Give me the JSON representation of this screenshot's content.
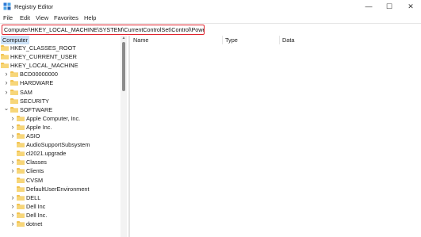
{
  "window": {
    "title": "Registry Editor",
    "controls": {
      "minimize": "—",
      "maximize": "☐",
      "close": "✕"
    }
  },
  "menu": [
    "File",
    "Edit",
    "View",
    "Favorites",
    "Help"
  ],
  "address": {
    "value": "Computer\\HKEY_LOCAL_MACHINE\\SYSTEM\\CurrentControlSet\\Control\\Power"
  },
  "tree": {
    "root": "Computer",
    "items": [
      {
        "label": "HKEY_CLASSES_ROOT",
        "level": 0,
        "expandable": false
      },
      {
        "label": "HKEY_CURRENT_USER",
        "level": 0,
        "expandable": false
      },
      {
        "label": "HKEY_LOCAL_MACHINE",
        "level": 0,
        "expandable": false
      },
      {
        "label": "BCD00000000",
        "level": 1,
        "expandable": true
      },
      {
        "label": "HARDWARE",
        "level": 1,
        "expandable": true
      },
      {
        "label": "SAM",
        "level": 1,
        "expandable": true
      },
      {
        "label": "SECURITY",
        "level": 1,
        "expandable": false
      },
      {
        "label": "SOFTWARE",
        "level": 1,
        "expandable": true,
        "expanded": true
      },
      {
        "label": "Apple Computer, Inc.",
        "level": 2,
        "expandable": true
      },
      {
        "label": "Apple Inc.",
        "level": 2,
        "expandable": true
      },
      {
        "label": "ASIO",
        "level": 2,
        "expandable": true
      },
      {
        "label": "AudioSupportSubsystem",
        "level": 2,
        "expandable": false
      },
      {
        "label": "cl2021.upgrade",
        "level": 2,
        "expandable": false
      },
      {
        "label": "Classes",
        "level": 2,
        "expandable": true
      },
      {
        "label": "Clients",
        "level": 2,
        "expandable": true
      },
      {
        "label": "CVSM",
        "level": 2,
        "expandable": false
      },
      {
        "label": "DefaultUserEnvironment",
        "level": 2,
        "expandable": false
      },
      {
        "label": "DELL",
        "level": 2,
        "expandable": true
      },
      {
        "label": "Dell Inc",
        "level": 2,
        "expandable": true
      },
      {
        "label": "Dell Inc.",
        "level": 2,
        "expandable": true
      },
      {
        "label": "dotnet",
        "level": 2,
        "expandable": true
      }
    ]
  },
  "list": {
    "columns": [
      "Name",
      "Type",
      "Data"
    ]
  },
  "colors": {
    "highlight_border": "#e0242e",
    "folder": "#f2c24f",
    "selection": "#cde2f7"
  },
  "icons": {
    "app": "registry-editor-icon",
    "folder": "folder-icon",
    "chevron": "chevron-right-icon",
    "expanded": "chevron-down-icon"
  }
}
